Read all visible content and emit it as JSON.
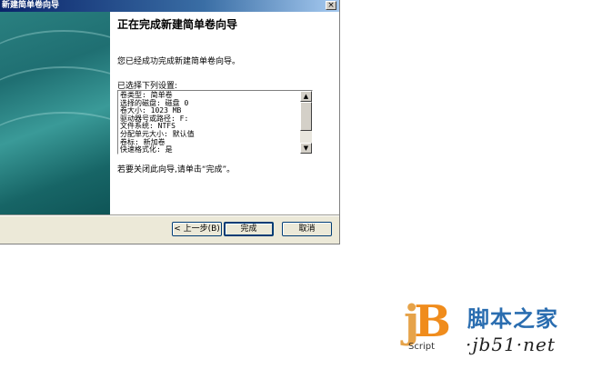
{
  "window": {
    "title": "新建简单卷向导",
    "close_glyph": "×"
  },
  "content": {
    "heading": "正在完成新建简单卷向导",
    "success_text": "您已经成功完成新建简单卷向导。",
    "settings_label": "已选择下列设置:",
    "summary_lines": [
      "卷类型: 简单卷",
      "选择的磁盘: 磁盘 0",
      "卷大小: 1023 MB",
      "驱动器号或路径: F:",
      "文件系统: NTFS",
      "分配单元大小: 默认值",
      "卷标: 新加卷",
      "快速格式化: 是"
    ],
    "close_hint": "若要关闭此向导,请单击“完成”。"
  },
  "buttons": {
    "back": "< 上一步(B)",
    "finish": "完成",
    "cancel": "取消"
  },
  "scrollbar": {
    "up_glyph": "▲",
    "down_glyph": "▼"
  },
  "watermark": {
    "logo_letters_j": "j",
    "logo_letters_b": "B",
    "script": "Script",
    "name": "脚本之家",
    "url": "·jb51·net"
  }
}
